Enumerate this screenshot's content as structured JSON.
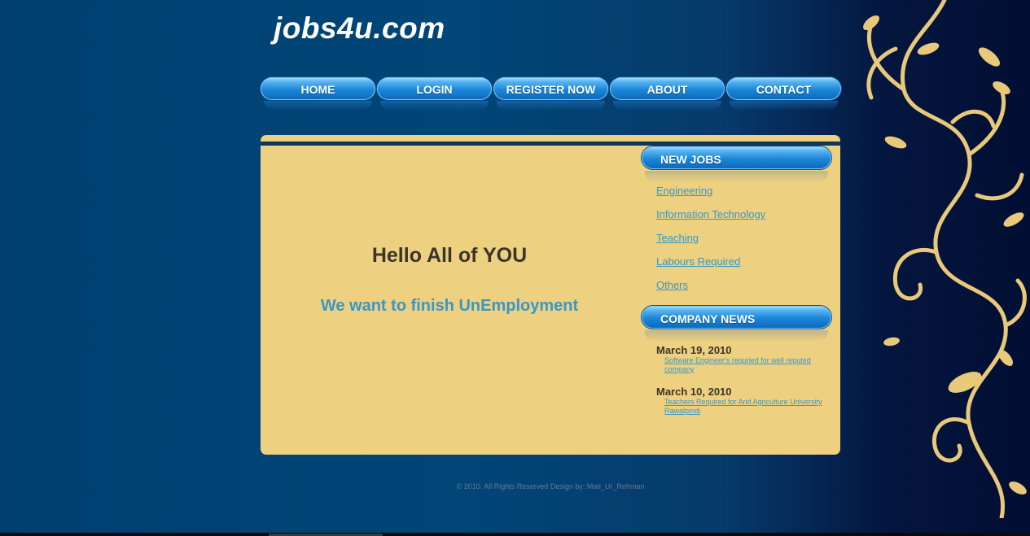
{
  "site": {
    "logo": "jobs4u.com"
  },
  "nav": {
    "items": [
      {
        "label": "HOME"
      },
      {
        "label": "LOGIN"
      },
      {
        "label": "REGISTER NOW"
      },
      {
        "label": "ABOUT"
      },
      {
        "label": "CONTACT"
      }
    ]
  },
  "main": {
    "heading": "Hello All of YOU",
    "tagline": "We want to finish UnEmployment"
  },
  "sidebar": {
    "new_jobs_title": "NEW JOBS",
    "jobs": [
      {
        "label": "Engineering"
      },
      {
        "label": "Information Technology"
      },
      {
        "label": "Teaching"
      },
      {
        "label": "Labours Required"
      },
      {
        "label": "Others"
      }
    ],
    "company_news_title": "COMPANY NEWS",
    "news": [
      {
        "date": "March 19, 2010",
        "text": "Software Engineer's requried for well reputed company"
      },
      {
        "date": "March 10, 2010",
        "text": "Teachers Required for Arid Agriculture University Rawalpindi"
      }
    ]
  },
  "footer": {
    "text": "© 2010. All Rights Reserved Design by: Mati_Ur_Rehman"
  },
  "colors": {
    "background": "#004677",
    "panel": "#edd080",
    "link": "#3a97c6",
    "heading": "#3c3428",
    "button": "#1b86d8",
    "ornament": "#e8c97a"
  }
}
